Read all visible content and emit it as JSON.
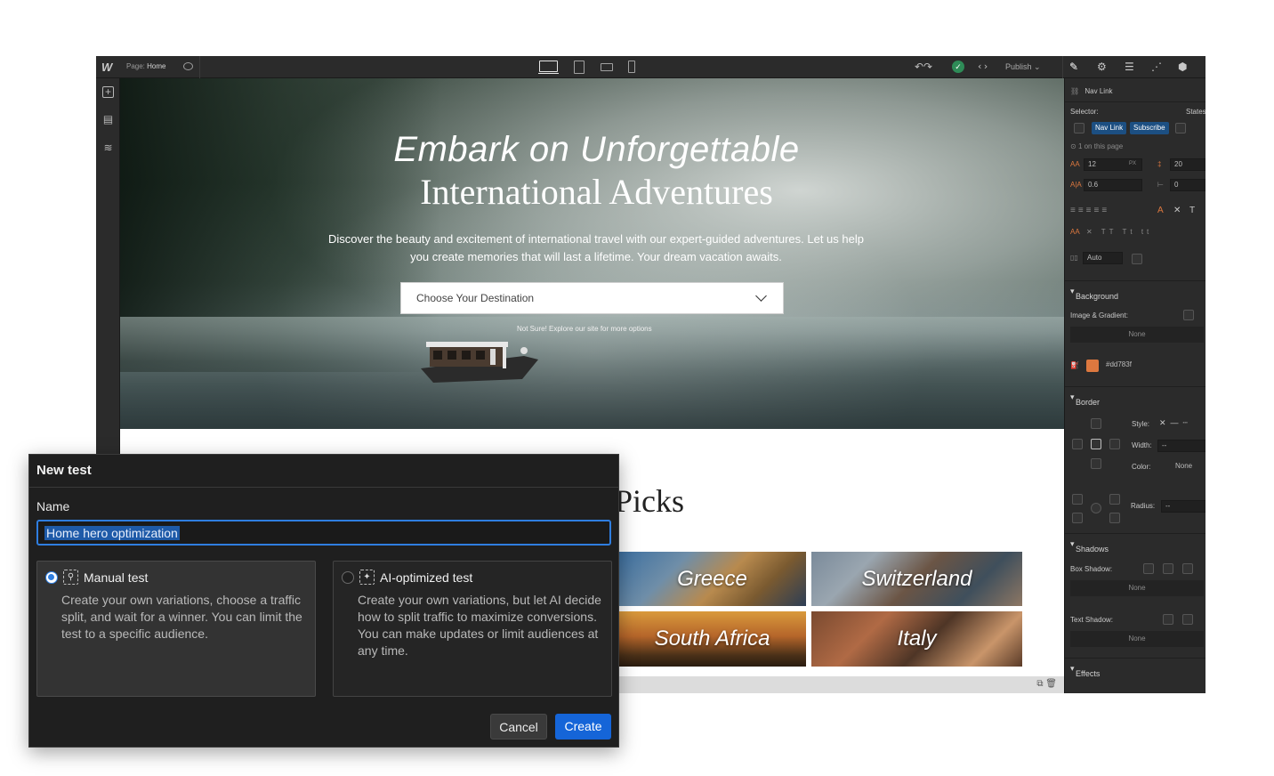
{
  "topbar": {
    "logo": "W",
    "page_prefix": "Page:",
    "page_name": "Home",
    "publish_label": "Publish ⌄",
    "undo_redo": "↶↷",
    "code_label": "‹›"
  },
  "hero": {
    "title_line1": "Embark on Unforgettable",
    "title_line2": "International Adventures",
    "subtitle": "Discover the beauty and excitement of international travel with our expert-guided adventures. Let us help you create memories that will last a lifetime. Your dream vacation awaits.",
    "select_placeholder": "Choose Your Destination",
    "helper": "Not Sure! Explore our site for more options"
  },
  "picks": {
    "heading": "Picks",
    "destinations": [
      "Greece",
      "Switzerland",
      "South Africa",
      "Italy"
    ]
  },
  "panel": {
    "element_label": "Nav Link",
    "selector_label": "Selector:",
    "states_label": "States",
    "chips": [
      "Nav Link",
      "Subscribe"
    ],
    "on_page": "1 on this page",
    "font_size": "12",
    "font_unit": "PX",
    "line_height": "20",
    "letter_spacing": "0.6",
    "word_spacing": "0",
    "auto_label": "Auto",
    "background_header": "Background",
    "image_gradient_label": "Image & Gradient:",
    "none": "None",
    "bg_color_hex": "#dd783f",
    "border_header": "Border",
    "style_label": "Style:",
    "width_label": "Width:",
    "color_label": "Color:",
    "radius_label": "Radius:",
    "shadows_header": "Shadows",
    "box_shadow_label": "Box Shadow:",
    "text_shadow_label": "Text Shadow:",
    "effects_header": "Effects"
  },
  "dialog": {
    "title": "New test",
    "name_label": "Name",
    "name_value": "Home hero optimization",
    "options": [
      {
        "title": "Manual test",
        "description": "Create your own variations, choose a traffic split, and wait for a winner. You can limit the test to a specific audience.",
        "selected": true
      },
      {
        "title": "AI-optimized test",
        "description": "Create your own variations, but let AI decide how to split traffic to maximize conversions. You can make updates or limit audiences at any time.",
        "selected": false
      }
    ],
    "cancel_label": "Cancel",
    "create_label": "Create"
  },
  "colors": {
    "accent": "#2f7ee0",
    "create_button": "#1565d8",
    "bg_swatch": "#dd783f",
    "publish_ok": "#2e8b57"
  }
}
